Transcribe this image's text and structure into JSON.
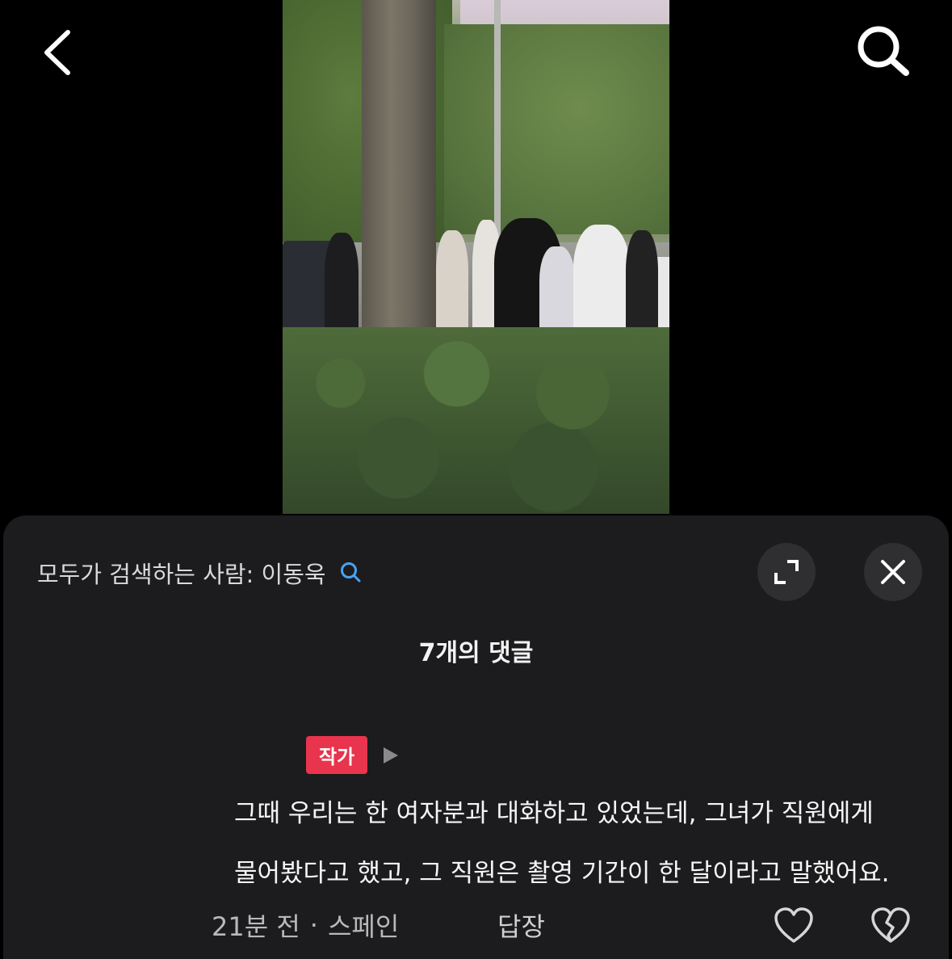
{
  "topbar": {
    "back_icon": "chevron-left-icon",
    "search_icon": "search-icon"
  },
  "media": {
    "description_icon": "video-frame"
  },
  "sheet": {
    "header_text": "모두가 검색하는 사람: 이동욱",
    "header_icon": "search-icon",
    "expand_icon": "expand-icon",
    "close_icon": "close-icon",
    "comments_title": "7개의 댓글"
  },
  "comment": {
    "badge": "작가",
    "lines": [
      "그때 우리는 한 여자분과 대화하고 있었는데, 그녀가 직원에게",
      "물어봤다고 했고, 그 직원은 촬영 기간이 한 달이라고 말했어요."
    ],
    "time": "21분 전",
    "separator": "·",
    "location": "스페인",
    "reply_label": "답장"
  },
  "colors": {
    "sheet_bg": "#1c1c1e",
    "badge_bg": "#e8344c",
    "accent_search": "#4aa3f0"
  }
}
